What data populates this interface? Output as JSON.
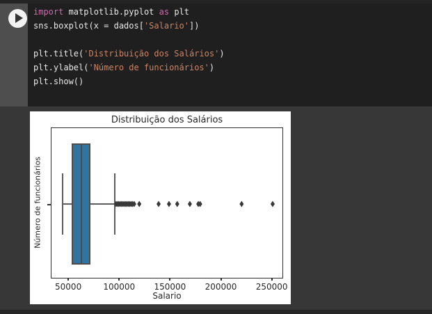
{
  "editor": {
    "syntax_colors": {
      "keyword": "#cc6bb1",
      "string": "#ce8465",
      "plain": "#e8e8e8"
    },
    "lines": [
      {
        "tokens": [
          [
            "keyword",
            "import"
          ],
          [
            "plain",
            " matplotlib.pyplot "
          ],
          [
            "keyword",
            "as"
          ],
          [
            "plain",
            " plt"
          ]
        ]
      },
      {
        "tokens": [
          [
            "plain",
            "sns.boxplot(x = dados["
          ],
          [
            "string",
            "'Salario'"
          ],
          [
            "plain",
            "])"
          ]
        ]
      },
      {
        "tokens": []
      },
      {
        "tokens": [
          [
            "plain",
            "plt.title("
          ],
          [
            "string",
            "'Distribuição dos Salários'"
          ],
          [
            "plain",
            ")"
          ]
        ]
      },
      {
        "tokens": [
          [
            "plain",
            "plt.ylabel("
          ],
          [
            "string",
            "'Número de funcionários'"
          ],
          [
            "plain",
            ")"
          ]
        ]
      },
      {
        "tokens": [
          [
            "plain",
            "plt.show()"
          ]
        ]
      }
    ]
  },
  "run_button": {
    "icon": "play-icon"
  },
  "chart_data": {
    "type": "boxplot",
    "orientation": "horizontal",
    "title": "Distribuição dos Salários",
    "xlabel": "Salario",
    "ylabel": "Número de funcionários",
    "xlim": [
      33500,
      260500
    ],
    "xticks": [
      50000,
      100000,
      150000,
      200000,
      250000
    ],
    "grid": false,
    "box": {
      "whisker_low": 44300,
      "q1": 53500,
      "median": 62700,
      "q3": 71500,
      "whisker_high": 96000
    },
    "outliers": [
      97000,
      98400,
      99700,
      101100,
      102400,
      103800,
      105100,
      106500,
      107800,
      109200,
      110500,
      111900,
      113200,
      114800,
      119800,
      138800,
      149000,
      157100,
      169500,
      177800,
      179600,
      220400,
      250900
    ],
    "colors": {
      "box_fill": "#3274a1",
      "box_edge": "#4c4c4c",
      "whisker": "#5c5c5c",
      "outlier": "#383838",
      "figure_bg": "#ffffff"
    }
  }
}
